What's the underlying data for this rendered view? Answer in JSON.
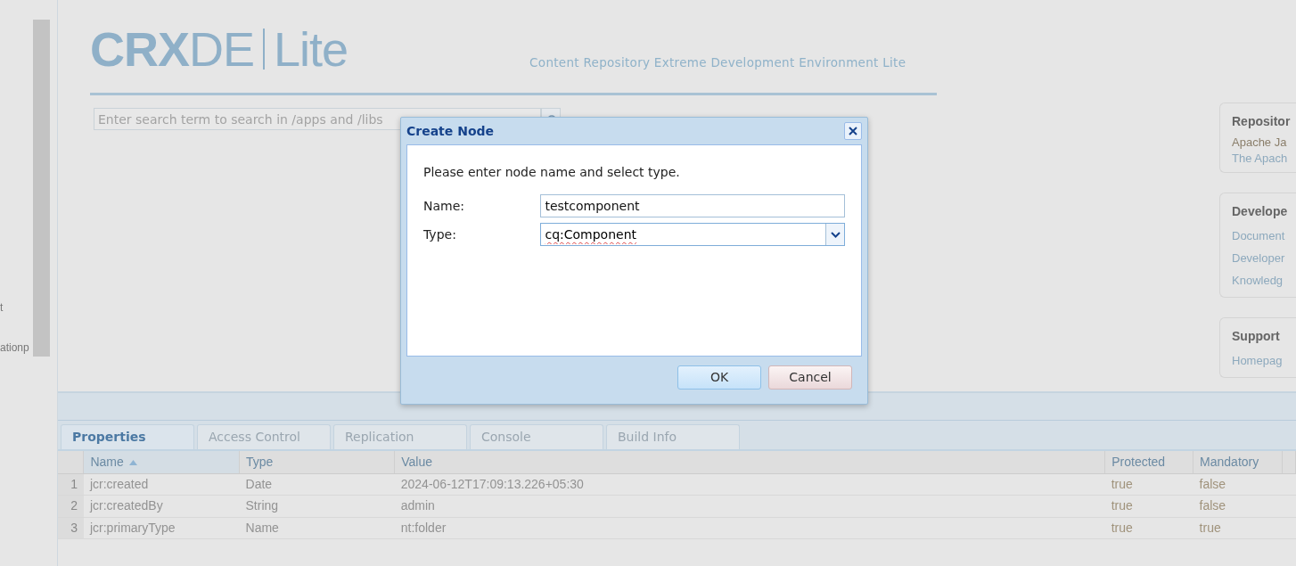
{
  "sidebar": {
    "items": [
      {
        "label": "t"
      },
      {
        "label": "ationp"
      }
    ]
  },
  "header": {
    "logo": "**CRX**DE",
    "logo_sub": "Lite",
    "tagline": "Content Repository Extreme Development Environment Lite"
  },
  "search": {
    "placeholder": "Enter search term to search in /apps and /libs"
  },
  "info_cards": [
    {
      "title": "Repositor",
      "links": [
        {
          "label": "Apache Ja",
          "kind": "text"
        },
        {
          "label": "The Apach",
          "kind": "link"
        }
      ]
    },
    {
      "title": "Develope",
      "links": [
        {
          "label": "Document",
          "kind": "link"
        },
        {
          "label": "Developer",
          "kind": "link"
        },
        {
          "label": "Knowledg",
          "kind": "link"
        }
      ]
    },
    {
      "title": "Support",
      "links": [
        {
          "label": "Homepag",
          "kind": "link"
        }
      ]
    }
  ],
  "tabs": [
    {
      "label": "Properties",
      "selected": true
    },
    {
      "label": "Access Control",
      "selected": false
    },
    {
      "label": "Replication",
      "selected": false
    },
    {
      "label": "Console",
      "selected": false
    },
    {
      "label": "Build Info",
      "selected": false
    }
  ],
  "table": {
    "columns": [
      {
        "label": "Name",
        "sorted": true
      },
      {
        "label": "Type",
        "sorted": false
      },
      {
        "label": "Value",
        "sorted": false
      },
      {
        "label": "Protected",
        "sorted": false
      },
      {
        "label": "Mandatory",
        "sorted": false
      }
    ],
    "rows": [
      {
        "index": "1",
        "cells": [
          "jcr:created",
          "Date",
          "2024-06-12T17:09:13.226+05:30",
          "true",
          "false"
        ]
      },
      {
        "index": "2",
        "cells": [
          "jcr:createdBy",
          "String",
          "admin",
          "true",
          "false"
        ]
      },
      {
        "index": "3",
        "cells": [
          "jcr:primaryType",
          "Name",
          "nt:folder",
          "true",
          "true"
        ]
      }
    ]
  },
  "dialog": {
    "title": "Create Node",
    "message": "Please enter node name and select type.",
    "fields": [
      {
        "label": "Name:",
        "value": "testcomponent",
        "kind": "text"
      },
      {
        "label": "Type:",
        "value": "cq:Component",
        "kind": "combo"
      }
    ],
    "buttons": [
      {
        "label": "OK",
        "kind": "primary"
      },
      {
        "label": "Cancel",
        "kind": "secondary"
      }
    ]
  }
}
